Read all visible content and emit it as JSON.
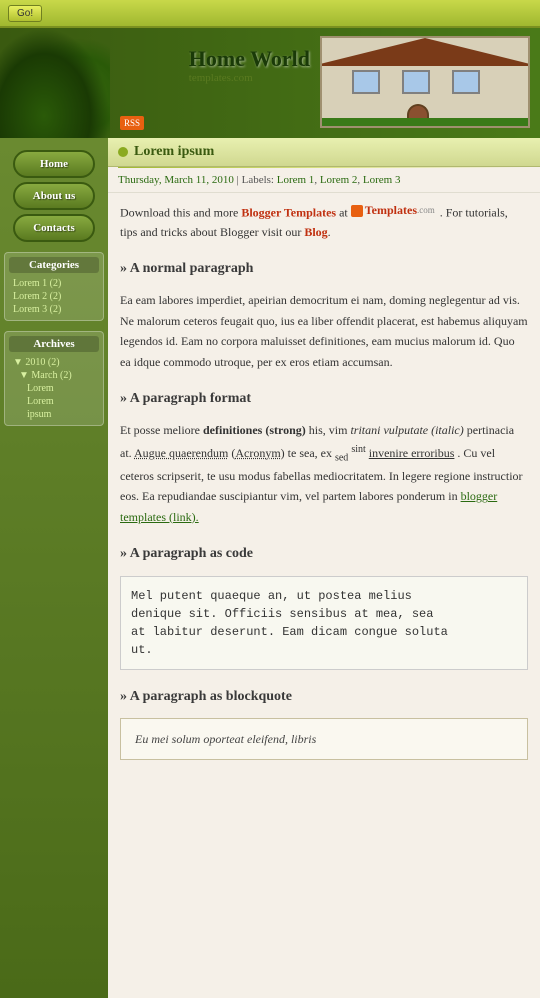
{
  "topbar": {
    "go_label": "Go!"
  },
  "header": {
    "title": "Home World",
    "subtitle": "templates.com",
    "rss": "RSS"
  },
  "nav": {
    "home_label": "Home",
    "about_label": "About us",
    "contacts_label": "Contacts"
  },
  "sidebar": {
    "categories_label": "Categories",
    "categories": [
      {
        "label": "Lorem 1 (2)"
      },
      {
        "label": "Lorem 2 (2)"
      },
      {
        "label": "Lorem 3 (2)"
      }
    ],
    "archives_label": "Archives",
    "archives": [
      {
        "label": "▼ 2010 (2)",
        "indent": 0
      },
      {
        "label": "▼ March (2)",
        "indent": 1
      },
      {
        "label": "Lorem",
        "indent": 2
      },
      {
        "label": "Lorem",
        "indent": 2
      },
      {
        "label": "ipsum",
        "indent": 2
      }
    ]
  },
  "post": {
    "title": "Lorem ipsum",
    "date": "Thursday, March 11, 2010",
    "labels_prefix": "Labels:",
    "labels": [
      {
        "text": "Lorem 1",
        "url": "#"
      },
      {
        "text": "Lorem 2",
        "url": "#"
      },
      {
        "text": "Lorem 3",
        "url": "#"
      }
    ],
    "download_text": "Download this and more",
    "download_link_text": "Blogger Templates",
    "at_text": "at",
    "templates_brand": "Templates",
    "templates_com": ".com",
    "for_tutorials": ". For tutorials, tips and tricks about Blogger visit our",
    "blog_link": "Blog",
    "blog_end": ".",
    "section1_heading": "» A normal paragraph",
    "section1_text": "Ea eam labores imperdiet, apeirian democritum ei nam, doming neglegentur ad vis. Ne malorum ceteros feugait quo, ius ea liber offendit placerat, est habemus aliquyam legendos id. Eam no corpora maluisset definitiones, eam mucius malorum id. Quo ea idque commodo utroque, per ex eros etiam accumsan.",
    "section2_heading": "» A paragraph format",
    "section2_before": "Et posse meliore",
    "section2_strong": "definitiones (strong)",
    "section2_middle": "his, vim",
    "section2_italic": "tritani vulputate (italic)",
    "section2_after1": "pertinacia at.",
    "section2_abbr": "Augue quaerendum",
    "section2_acronym_label": "Acronym",
    "section2_after2": "te sea, ex",
    "section2_sub": "sed",
    "section2_sup": "sint",
    "section2_underline": "invenire erroribus",
    "section2_rest": ". Cu vel ceteros scripserit, te usu modus fabellas mediocritatem. In legere regione instructior eos. Ea repudiandae suscipiantur vim, vel partem labores ponderum in",
    "section2_link": "blogger templates (link).",
    "section3_heading": "» A paragraph as code",
    "section3_code": "Mel putent quaeque an, ut postea melius\ndenique sit. Officiis sensibus at mea, sea\nat labitur deserunt. Eam dicam congue soluta\nut.",
    "section4_heading": "» A paragraph as blockquote",
    "section4_quote": "Eu mei solum oporteat eleifend, libris"
  }
}
